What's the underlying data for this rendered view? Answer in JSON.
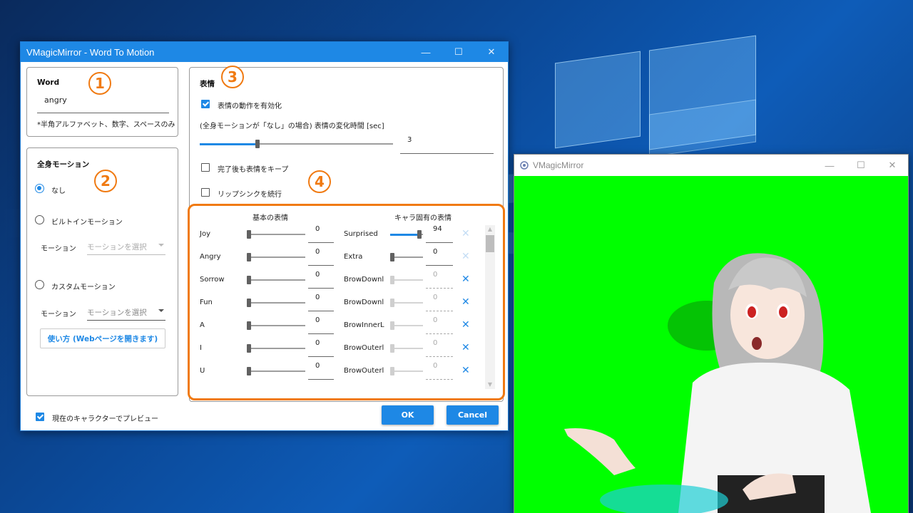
{
  "colors": {
    "accent": "#1e88e5",
    "annotation": "#f07a12",
    "greenscreen": "#00ff00"
  },
  "dialog": {
    "title": "VMagicMirror - Word To Motion",
    "controls": {
      "minimize": "—",
      "maximize": "☐",
      "close": "✕"
    },
    "word_panel": {
      "title": "Word",
      "value": "angry",
      "hint": "*半角アルファベット、数字、スペースのみ"
    },
    "motion_panel": {
      "title": "全身モーション",
      "option_none": "なし",
      "option_builtin": "ビルトインモーション",
      "builtin_motion_label": "モーション",
      "builtin_motion_placeholder": "モーションを選択",
      "option_custom": "カスタムモーション",
      "custom_motion_label": "モーション",
      "custom_motion_placeholder": "モーションを選択",
      "help_button": "使い方 (Webページを開きます)"
    },
    "expression_panel": {
      "title": "表情",
      "enable_label": "表情の動作を有効化",
      "transition_label": "(全身モーションが「なし」の場合) 表情の変化時間 [sec]",
      "transition_value": "3",
      "transition_level": 0.3,
      "keep_label": "完了後も表情をキープ",
      "lipsync_label": "リップシンクを続行",
      "basic_header": "基本の表情",
      "custom_header": "キャラ固有の表情",
      "basic": [
        {
          "name": "Joy",
          "value": "0"
        },
        {
          "name": "Angry",
          "value": "0"
        },
        {
          "name": "Sorrow",
          "value": "0"
        },
        {
          "name": "Fun",
          "value": "0"
        },
        {
          "name": "A",
          "value": "0"
        },
        {
          "name": "I",
          "value": "0"
        },
        {
          "name": "U",
          "value": "0"
        }
      ],
      "custom": [
        {
          "name": "Surprised",
          "value": "94",
          "level": 0.94,
          "enabled": true,
          "remove": "✕"
        },
        {
          "name": "Extra",
          "value": "0",
          "level": 0,
          "enabled": true,
          "remove": "✕"
        },
        {
          "name": "BrowDownl",
          "value": "0",
          "level": 0,
          "enabled": false,
          "remove": "✕"
        },
        {
          "name": "BrowDownl",
          "value": "0",
          "level": 0,
          "enabled": false,
          "remove": "✕"
        },
        {
          "name": "BrowInnerL",
          "value": "0",
          "level": 0,
          "enabled": false,
          "remove": "✕"
        },
        {
          "name": "BrowOuterl",
          "value": "0",
          "level": 0,
          "enabled": false,
          "remove": "✕"
        },
        {
          "name": "BrowOuterl",
          "value": "0",
          "level": 0,
          "enabled": false,
          "remove": "✕"
        }
      ]
    },
    "preview_label": "現在のキャラクターでプレビュー",
    "ok_button": "OK",
    "cancel_button": "Cancel",
    "annotations": [
      "1",
      "2",
      "3",
      "4"
    ]
  },
  "preview_window": {
    "title": "VMagicMirror",
    "controls": {
      "minimize": "—",
      "maximize": "☐",
      "close": "✕"
    }
  }
}
